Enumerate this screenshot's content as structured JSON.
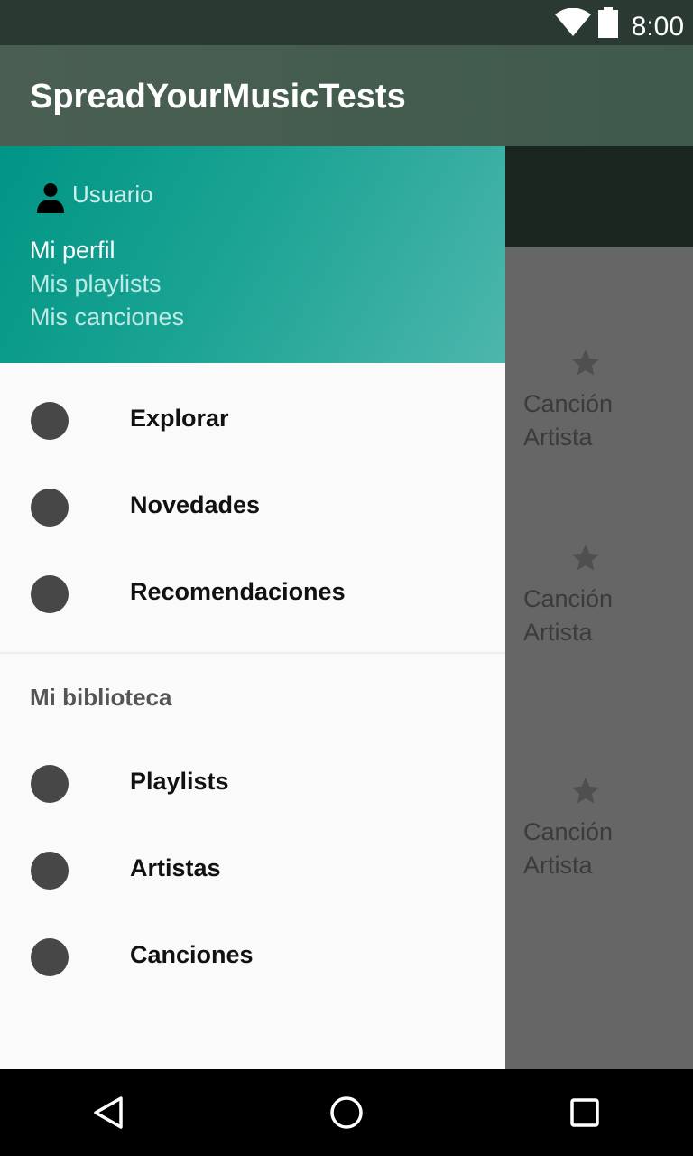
{
  "status_bar": {
    "time": "8:00",
    "icons": [
      "wifi-icon",
      "battery-icon"
    ]
  },
  "app_bar": {
    "title": "SpreadYourMusicTests"
  },
  "drawer": {
    "header": {
      "user_icon": "person-icon",
      "username": "Usuario",
      "links": [
        "Mi perfil",
        "Mis playlists",
        "Mis canciones"
      ]
    },
    "main_items": [
      {
        "label": "Explorar",
        "icon": "circle-icon"
      },
      {
        "label": "Novedades",
        "icon": "circle-icon"
      },
      {
        "label": "Recomendaciones",
        "icon": "circle-icon"
      }
    ],
    "section_title": "Mi biblioteca",
    "library_items": [
      {
        "label": "Playlists",
        "icon": "circle-icon"
      },
      {
        "label": "Artistas",
        "icon": "circle-icon"
      },
      {
        "label": "Canciones",
        "icon": "circle-icon"
      }
    ]
  },
  "background_list": [
    {
      "song": "Canción",
      "artist": "Artista",
      "icon": "star-icon"
    },
    {
      "song": "Canción",
      "artist": "Artista",
      "icon": "star-icon"
    },
    {
      "song": "Canción",
      "artist": "Artista",
      "icon": "star-icon"
    }
  ],
  "nav_bar": {
    "buttons": [
      "back-icon",
      "home-icon",
      "recents-icon"
    ]
  },
  "colors": {
    "header_start": "#009585",
    "header_end": "#4db6ac",
    "app_bar": "#455a4e",
    "scrim": "#666666"
  }
}
